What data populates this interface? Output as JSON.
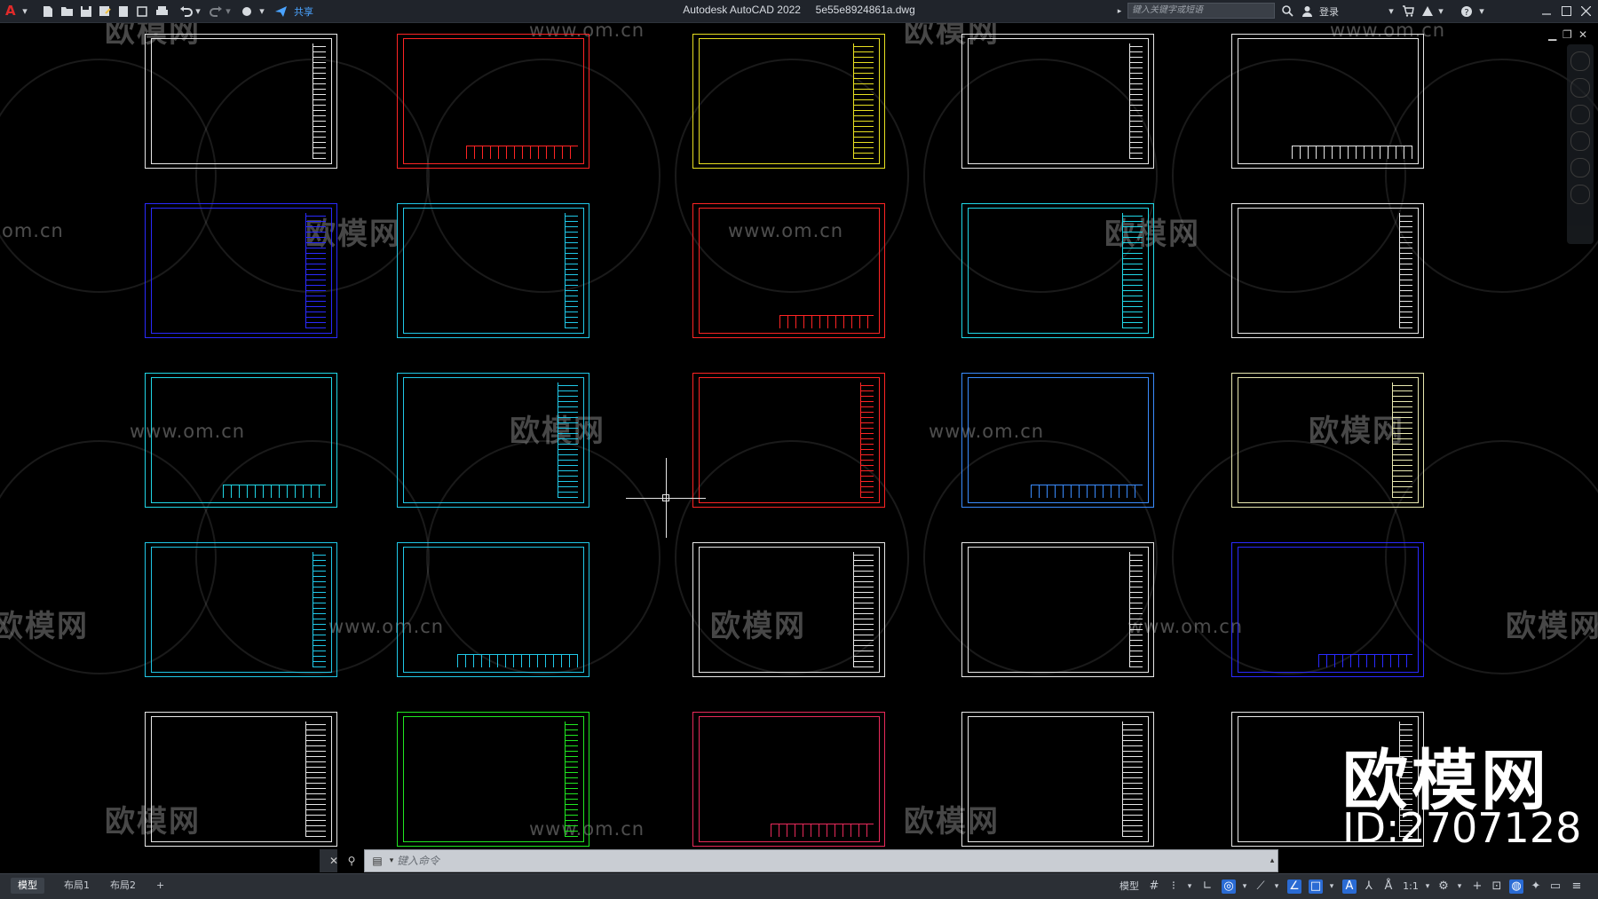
{
  "app": {
    "logo": "A",
    "title": "Autodesk AutoCAD 2022",
    "filename": "5e55e8924861a.dwg",
    "share_label": "共享",
    "search_placeholder": "键入关键字或短语",
    "login_label": "登录"
  },
  "quick_access": [
    "new-file-icon",
    "open-file-icon",
    "save-icon",
    "save-as-icon",
    "plot-icon",
    "publish-icon",
    "print-icon",
    "undo-icon",
    "redo-icon",
    "workspace-icon",
    "share-icon"
  ],
  "watermark": {
    "logo_text": "欧模网",
    "url_text": "www.om.cn",
    "url_fragment": "om.cn",
    "brand_big": "欧模网",
    "id_text": "ID:2707128"
  },
  "sheets_colors": [
    [
      "#e8e8e8",
      "#ff2424",
      "#e8e020",
      "#e8e8e8",
      "#e8e8e8"
    ],
    [
      "#2a2aff",
      "#20c8e8",
      "#ff2424",
      "#20d8e8",
      "#e8e8e8"
    ],
    [
      "#20d8e8",
      "#20c8e8",
      "#ff2424",
      "#3a8cff",
      "#e8e8b0"
    ],
    [
      "#20c8e8",
      "#20c8e8",
      "#e8e8e8",
      "#e8e8e8",
      "#2a2aff"
    ],
    [
      "#e8e8e8",
      "#20e820",
      "#e82a5a",
      "#e8e8e8",
      "#e8e8e8"
    ]
  ],
  "command": {
    "placeholder": "键入命令"
  },
  "tabs": [
    {
      "label": "模型",
      "active": true
    },
    {
      "label": "布局1",
      "active": false
    },
    {
      "label": "布局2",
      "active": false
    },
    {
      "label": "+",
      "active": false
    }
  ],
  "status": {
    "model_label": "模型",
    "scale_label": "1:1"
  }
}
